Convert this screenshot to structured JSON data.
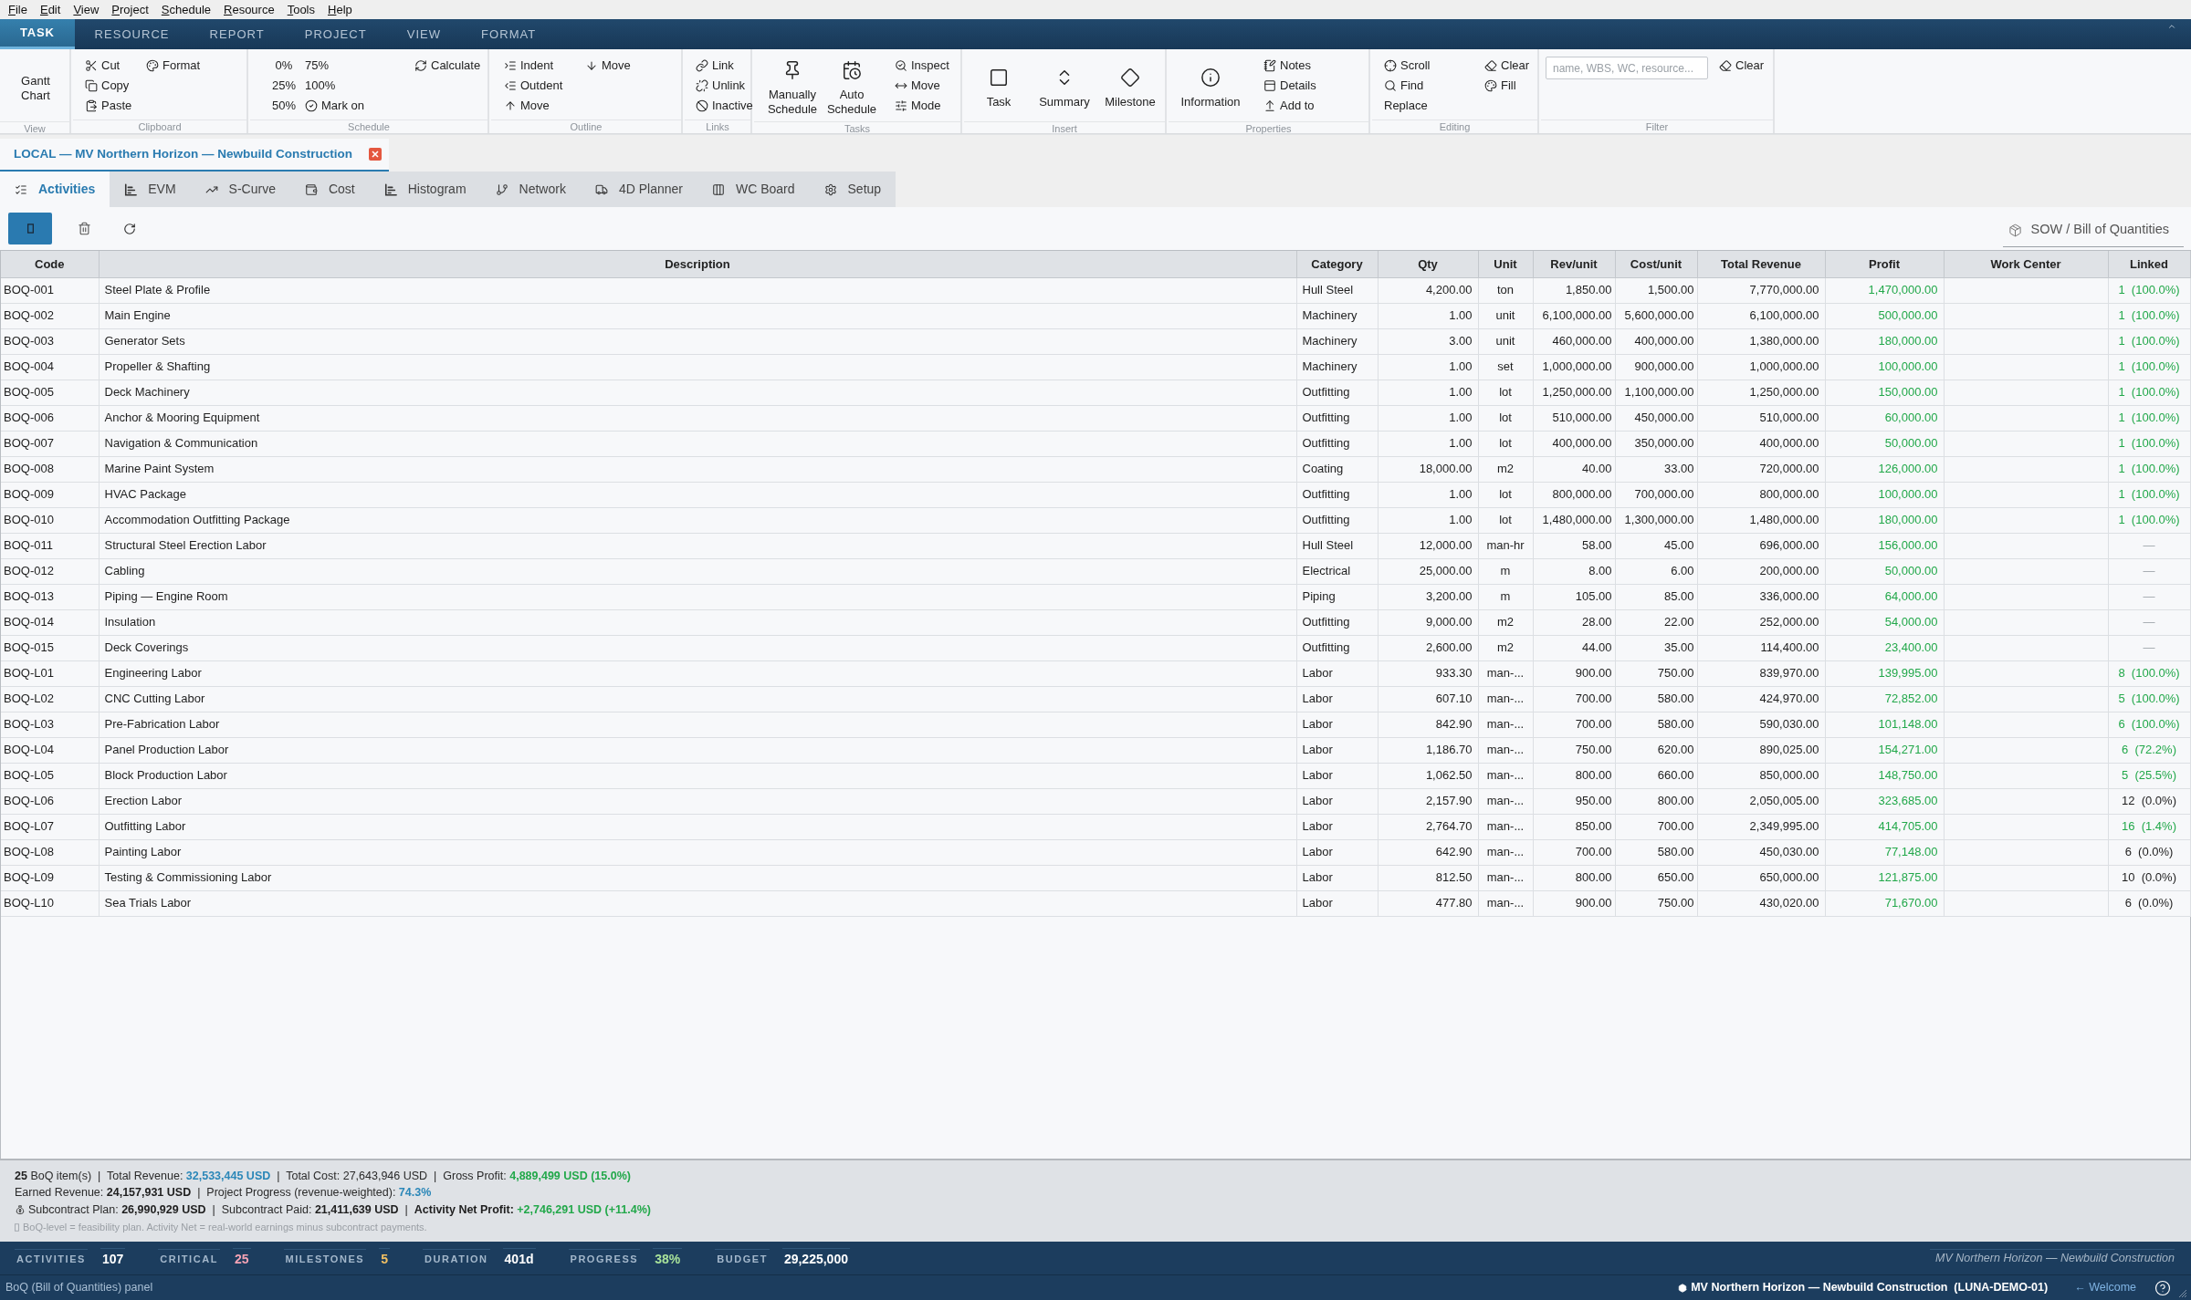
{
  "menu_bar": [
    "File",
    "Edit",
    "View",
    "Project",
    "Schedule",
    "Resource",
    "Tools",
    "Help"
  ],
  "ribbon": {
    "tabs": [
      {
        "label": "TASK",
        "selected": true
      },
      {
        "label": "RESOURCE",
        "selected": false
      },
      {
        "label": "REPORT",
        "selected": false
      },
      {
        "label": "PROJECT",
        "selected": false
      },
      {
        "label": "VIEW",
        "selected": false
      },
      {
        "label": "FORMAT",
        "selected": false
      }
    ],
    "groups": [
      {
        "label": "View",
        "columns": [
          [
            {
              "label": "Gantt Chart",
              "kind": "large"
            }
          ]
        ]
      },
      {
        "label": "Clipboard",
        "columns": [
          [
            {
              "label": "Cut",
              "kind": "small"
            },
            {
              "label": "Copy",
              "kind": "small"
            },
            {
              "label": "Paste",
              "kind": "small"
            }
          ],
          [
            {
              "label": "Format",
              "kind": "small"
            }
          ]
        ]
      },
      {
        "label": "Schedule",
        "columns": [
          [
            {
              "label": "0%",
              "kind": "small"
            },
            {
              "label": "25%",
              "kind": "small"
            },
            {
              "label": "50%",
              "kind": "small"
            }
          ],
          [
            {
              "label": "75%",
              "kind": "small"
            },
            {
              "label": "100%",
              "kind": "small"
            },
            {
              "label": "Mark on",
              "kind": "small"
            }
          ],
          [
            {
              "label": "Calculate",
              "kind": "small"
            }
          ]
        ]
      },
      {
        "label": "Outline",
        "columns": [
          [
            {
              "label": "Indent",
              "kind": "small"
            },
            {
              "label": "Outdent",
              "kind": "small"
            },
            {
              "label": "Move",
              "kind": "small"
            }
          ],
          [
            {
              "label": "Move",
              "kind": "small"
            }
          ]
        ]
      },
      {
        "label": "Links",
        "columns": [
          [
            {
              "label": "Link",
              "kind": "small"
            },
            {
              "label": "Unlink",
              "kind": "small"
            },
            {
              "label": "Inactive",
              "kind": "small"
            }
          ]
        ]
      },
      {
        "label": "Tasks",
        "columns": [
          [
            {
              "label": "Manually Schedule",
              "kind": "large"
            }
          ],
          [
            {
              "label": "Auto Schedule",
              "kind": "large"
            }
          ],
          [
            {
              "label": "Inspect",
              "kind": "small"
            },
            {
              "label": "Move",
              "kind": "small"
            },
            {
              "label": "Mode",
              "kind": "small"
            }
          ]
        ]
      },
      {
        "label": "Insert",
        "columns": [
          [
            {
              "label": "Task",
              "kind": "large"
            }
          ],
          [
            {
              "label": "Summary",
              "kind": "large"
            }
          ],
          [
            {
              "label": "Milestone",
              "kind": "large"
            }
          ]
        ]
      },
      {
        "label": "Properties",
        "columns": [
          [
            {
              "label": "Information",
              "kind": "large"
            }
          ],
          [
            {
              "label": "Notes",
              "kind": "small"
            },
            {
              "label": "Details",
              "kind": "small"
            },
            {
              "label": "Add to",
              "kind": "small"
            }
          ]
        ]
      },
      {
        "label": "Editing",
        "columns": [
          [
            {
              "label": "Scroll",
              "kind": "small"
            },
            {
              "label": "Find",
              "kind": "small"
            },
            {
              "label": "Replace",
              "kind": "small"
            }
          ],
          [
            {
              "label": "Clear",
              "kind": "small"
            },
            {
              "label": "Fill",
              "kind": "small"
            }
          ]
        ]
      },
      {
        "label": "Filter",
        "field": {
          "placeholder": "name, WBS, WC, resource..."
        },
        "columns": [
          [
            {
              "label": "Clear",
              "kind": "small"
            }
          ]
        ]
      }
    ]
  },
  "document_tab": {
    "label": "LOCAL — MV Northern Horizon — Newbuild Construction",
    "selected": true
  },
  "view_tabs": [
    {
      "label": "Activities",
      "selected": true
    },
    {
      "label": "EVM",
      "selected": false
    },
    {
      "label": "S-Curve",
      "selected": false
    },
    {
      "label": "Cost",
      "selected": false
    },
    {
      "label": "Histogram",
      "selected": false
    },
    {
      "label": "Network",
      "selected": false
    },
    {
      "label": "4D Planner",
      "selected": false
    },
    {
      "label": "WC Board",
      "selected": false
    },
    {
      "label": "Setup",
      "selected": false
    }
  ],
  "toolbar": {
    "panel_title": "SOW / Bill of Quantities"
  },
  "table": {
    "columns": [
      "Code",
      "Description",
      "Category",
      "Qty",
      "Unit",
      "Rev/unit",
      "Cost/unit",
      "Total Revenue",
      "Profit",
      "Work Center",
      "Linked"
    ],
    "rows": [
      {
        "code": "BOQ-001",
        "description": "Steel Plate & Profile",
        "category": "Hull Steel",
        "qty": "4,200.00",
        "unit": "ton",
        "rev_unit": "1,850.00",
        "cost_unit": "1,500.00",
        "total_revenue": "7,770,000.00",
        "profit": "1,470,000.00",
        "linked": {
          "text": "1  (100.0%)",
          "kind": "progress"
        }
      },
      {
        "code": "BOQ-002",
        "description": "Main Engine",
        "category": "Machinery",
        "qty": "1.00",
        "unit": "unit",
        "rev_unit": "6,100,000.00",
        "cost_unit": "5,600,000.00",
        "total_revenue": "6,100,000.00",
        "profit": "500,000.00",
        "linked": {
          "text": "1  (100.0%)",
          "kind": "progress"
        }
      },
      {
        "code": "BOQ-003",
        "description": "Generator Sets",
        "category": "Machinery",
        "qty": "3.00",
        "unit": "unit",
        "rev_unit": "460,000.00",
        "cost_unit": "400,000.00",
        "total_revenue": "1,380,000.00",
        "profit": "180,000.00",
        "linked": {
          "text": "1  (100.0%)",
          "kind": "progress"
        }
      },
      {
        "code": "BOQ-004",
        "description": "Propeller & Shafting",
        "category": "Machinery",
        "qty": "1.00",
        "unit": "set",
        "rev_unit": "1,000,000.00",
        "cost_unit": "900,000.00",
        "total_revenue": "1,000,000.00",
        "profit": "100,000.00",
        "linked": {
          "text": "1  (100.0%)",
          "kind": "progress"
        }
      },
      {
        "code": "BOQ-005",
        "description": "Deck Machinery",
        "category": "Outfitting",
        "qty": "1.00",
        "unit": "lot",
        "rev_unit": "1,250,000.00",
        "cost_unit": "1,100,000.00",
        "total_revenue": "1,250,000.00",
        "profit": "150,000.00",
        "linked": {
          "text": "1  (100.0%)",
          "kind": "progress"
        }
      },
      {
        "code": "BOQ-006",
        "description": "Anchor & Mooring Equipment",
        "category": "Outfitting",
        "qty": "1.00",
        "unit": "lot",
        "rev_unit": "510,000.00",
        "cost_unit": "450,000.00",
        "total_revenue": "510,000.00",
        "profit": "60,000.00",
        "linked": {
          "text": "1  (100.0%)",
          "kind": "progress"
        }
      },
      {
        "code": "BOQ-007",
        "description": "Navigation & Communication",
        "category": "Outfitting",
        "qty": "1.00",
        "unit": "lot",
        "rev_unit": "400,000.00",
        "cost_unit": "350,000.00",
        "total_revenue": "400,000.00",
        "profit": "50,000.00",
        "linked": {
          "text": "1  (100.0%)",
          "kind": "progress"
        }
      },
      {
        "code": "BOQ-008",
        "description": "Marine Paint System",
        "category": "Coating",
        "qty": "18,000.00",
        "unit": "m2",
        "rev_unit": "40.00",
        "cost_unit": "33.00",
        "total_revenue": "720,000.00",
        "profit": "126,000.00",
        "linked": {
          "text": "1  (100.0%)",
          "kind": "progress"
        }
      },
      {
        "code": "BOQ-009",
        "description": "HVAC Package",
        "category": "Outfitting",
        "qty": "1.00",
        "unit": "lot",
        "rev_unit": "800,000.00",
        "cost_unit": "700,000.00",
        "total_revenue": "800,000.00",
        "profit": "100,000.00",
        "linked": {
          "text": "1  (100.0%)",
          "kind": "progress"
        }
      },
      {
        "code": "BOQ-010",
        "description": "Accommodation Outfitting Package",
        "category": "Outfitting",
        "qty": "1.00",
        "unit": "lot",
        "rev_unit": "1,480,000.00",
        "cost_unit": "1,300,000.00",
        "total_revenue": "1,480,000.00",
        "profit": "180,000.00",
        "linked": {
          "text": "1  (100.0%)",
          "kind": "progress"
        }
      },
      {
        "code": "BOQ-011",
        "description": "Structural Steel Erection Labor",
        "category": "Hull Steel",
        "qty": "12,000.00",
        "unit": "man-hr",
        "rev_unit": "58.00",
        "cost_unit": "45.00",
        "total_revenue": "696,000.00",
        "profit": "156,000.00",
        "linked": {
          "text": "—",
          "kind": "none"
        }
      },
      {
        "code": "BOQ-012",
        "description": "Cabling",
        "category": "Electrical",
        "qty": "25,000.00",
        "unit": "m",
        "rev_unit": "8.00",
        "cost_unit": "6.00",
        "total_revenue": "200,000.00",
        "profit": "50,000.00",
        "linked": {
          "text": "—",
          "kind": "none"
        }
      },
      {
        "code": "BOQ-013",
        "description": "Piping — Engine Room",
        "category": "Piping",
        "qty": "3,200.00",
        "unit": "m",
        "rev_unit": "105.00",
        "cost_unit": "85.00",
        "total_revenue": "336,000.00",
        "profit": "64,000.00",
        "linked": {
          "text": "—",
          "kind": "none"
        }
      },
      {
        "code": "BOQ-014",
        "description": "Insulation",
        "category": "Outfitting",
        "qty": "9,000.00",
        "unit": "m2",
        "rev_unit": "28.00",
        "cost_unit": "22.00",
        "total_revenue": "252,000.00",
        "profit": "54,000.00",
        "linked": {
          "text": "—",
          "kind": "none"
        }
      },
      {
        "code": "BOQ-015",
        "description": "Deck Coverings",
        "category": "Outfitting",
        "qty": "2,600.00",
        "unit": "m2",
        "rev_unit": "44.00",
        "cost_unit": "35.00",
        "total_revenue": "114,400.00",
        "profit": "23,400.00",
        "linked": {
          "text": "—",
          "kind": "none"
        }
      },
      {
        "code": "BOQ-L01",
        "description": "Engineering Labor",
        "category": "Labor",
        "qty": "933.30",
        "unit": "man-...",
        "rev_unit": "900.00",
        "cost_unit": "750.00",
        "total_revenue": "839,970.00",
        "profit": "139,995.00",
        "linked": {
          "text": "8  (100.0%)",
          "kind": "progress"
        }
      },
      {
        "code": "BOQ-L02",
        "description": "CNC Cutting Labor",
        "category": "Labor",
        "qty": "607.10",
        "unit": "man-...",
        "rev_unit": "700.00",
        "cost_unit": "580.00",
        "total_revenue": "424,970.00",
        "profit": "72,852.00",
        "linked": {
          "text": "5  (100.0%)",
          "kind": "progress"
        }
      },
      {
        "code": "BOQ-L03",
        "description": "Pre-Fabrication Labor",
        "category": "Labor",
        "qty": "842.90",
        "unit": "man-...",
        "rev_unit": "700.00",
        "cost_unit": "580.00",
        "total_revenue": "590,030.00",
        "profit": "101,148.00",
        "linked": {
          "text": "6  (100.0%)",
          "kind": "progress"
        }
      },
      {
        "code": "BOQ-L04",
        "description": "Panel Production Labor",
        "category": "Labor",
        "qty": "1,186.70",
        "unit": "man-...",
        "rev_unit": "750.00",
        "cost_unit": "620.00",
        "total_revenue": "890,025.00",
        "profit": "154,271.00",
        "linked": {
          "text": "6  (72.2%)",
          "kind": "progress"
        }
      },
      {
        "code": "BOQ-L05",
        "description": "Block Production Labor",
        "category": "Labor",
        "qty": "1,062.50",
        "unit": "man-...",
        "rev_unit": "800.00",
        "cost_unit": "660.00",
        "total_revenue": "850,000.00",
        "profit": "148,750.00",
        "linked": {
          "text": "5  (25.5%)",
          "kind": "progress"
        }
      },
      {
        "code": "BOQ-L06",
        "description": "Erection Labor",
        "category": "Labor",
        "qty": "2,157.90",
        "unit": "man-...",
        "rev_unit": "950.00",
        "cost_unit": "800.00",
        "total_revenue": "2,050,005.00",
        "profit": "323,685.00",
        "linked": {
          "text": "12  (0.0%)",
          "kind": "idle"
        }
      },
      {
        "code": "BOQ-L07",
        "description": "Outfitting Labor",
        "category": "Labor",
        "qty": "2,764.70",
        "unit": "man-...",
        "rev_unit": "850.00",
        "cost_unit": "700.00",
        "total_revenue": "2,349,995.00",
        "profit": "414,705.00",
        "linked": {
          "text": "16  (1.4%)",
          "kind": "progress"
        }
      },
      {
        "code": "BOQ-L08",
        "description": "Painting Labor",
        "category": "Labor",
        "qty": "642.90",
        "unit": "man-...",
        "rev_unit": "700.00",
        "cost_unit": "580.00",
        "total_revenue": "450,030.00",
        "profit": "77,148.00",
        "linked": {
          "text": "6  (0.0%)",
          "kind": "idle"
        }
      },
      {
        "code": "BOQ-L09",
        "description": "Testing & Commissioning Labor",
        "category": "Labor",
        "qty": "812.50",
        "unit": "man-...",
        "rev_unit": "800.00",
        "cost_unit": "650.00",
        "total_revenue": "650,000.00",
        "profit": "121,875.00",
        "linked": {
          "text": "10  (0.0%)",
          "kind": "idle"
        }
      },
      {
        "code": "BOQ-L10",
        "description": "Sea Trials Labor",
        "category": "Labor",
        "qty": "477.80",
        "unit": "man-...",
        "rev_unit": "900.00",
        "cost_unit": "750.00",
        "total_revenue": "430,020.00",
        "profit": "71,670.00",
        "linked": {
          "text": "6  (0.0%)",
          "kind": "idle"
        }
      }
    ]
  },
  "summary": {
    "lines": [
      {
        "kind": "totals",
        "segments": [
          {
            "text": "25",
            "kind": "strong"
          },
          {
            "text": " BoQ item(s)  |  Total Revenue: ",
            "kind": "plain"
          },
          {
            "text": "32,533,445 USD",
            "kind": "accent"
          },
          {
            "text": "  |  Total Cost: 27,643,946 USD  |  Gross Profit: ",
            "kind": "plain"
          },
          {
            "text": "4,889,499 USD (15.0%)",
            "kind": "positive"
          }
        ]
      },
      {
        "kind": "progress",
        "segments": [
          {
            "text": "Earned Revenue: ",
            "kind": "plain"
          },
          {
            "text": "24,157,931 USD",
            "kind": "strong"
          },
          {
            "text": "  |  Project Progress (revenue-weighted): ",
            "kind": "plain"
          },
          {
            "text": "74.3%",
            "kind": "accent"
          }
        ]
      },
      {
        "kind": "subcontract",
        "segments": [
          {
            "text": "Subcontract Plan: ",
            "kind": "plain"
          },
          {
            "text": "26,990,929 USD",
            "kind": "strong"
          },
          {
            "text": "  |  Subcontract Paid: ",
            "kind": "plain"
          },
          {
            "text": "21,411,639 USD",
            "kind": "strong"
          },
          {
            "text": "  |  ",
            "kind": "plain"
          },
          {
            "text": "Activity Net Profit: ",
            "kind": "strong"
          },
          {
            "text": "+2,746,291 USD (+11.4%)",
            "kind": "positive"
          }
        ]
      }
    ],
    "note": "BoQ-level = feasibility plan. Activity Net = real-world earnings minus subcontract payments."
  },
  "stats_bar": {
    "items": [
      {
        "label": "ACTIVITIES",
        "value": "107",
        "color": "#ffffff"
      },
      {
        "label": "CRITICAL",
        "value": "25",
        "color": "#f5a3b5"
      },
      {
        "label": "MILESTONES",
        "value": "5",
        "color": "#f2c063"
      },
      {
        "label": "DURATION",
        "value": "401d",
        "color": "#ffffff"
      },
      {
        "label": "PROGRESS",
        "value": "38%",
        "color": "#a8e29a"
      },
      {
        "label": "BUDGET",
        "value": "29,225,000",
        "color": "#ffffff"
      }
    ],
    "project_name": "MV Northern Horizon — Newbuild Construction"
  },
  "status_bar": {
    "message": "BoQ (Bill of Quantities) panel",
    "project": "MV Northern Horizon — Newbuild Construction  (LUNA-DEMO-01)",
    "welcome_link": "← Welcome"
  }
}
